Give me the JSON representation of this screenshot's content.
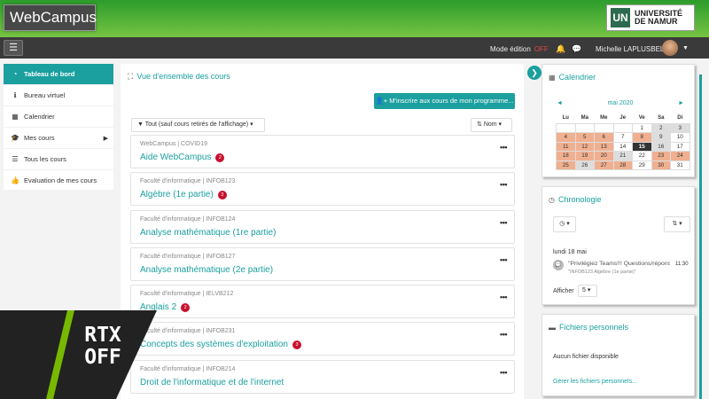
{
  "header": {
    "brand": "WebCampus",
    "university": [
      "UNIVERSITÉ",
      "DE NAMUR"
    ],
    "university_mark": "UN",
    "menu_icon": "hamburger-icon",
    "edit_mode_label": "Mode édition",
    "edit_mode_state": "OFF",
    "user_name": "Michelle LAPLUSBELLE",
    "icons": [
      "bell-icon",
      "chat-icon",
      "caret-down-icon"
    ],
    "accent": "#1b9f9f"
  },
  "sidebar": {
    "items": [
      {
        "label": "Tableau de bord",
        "icon": "dashboard-icon",
        "active": true
      },
      {
        "label": "Bureau virtuel",
        "icon": "info-icon"
      },
      {
        "label": "Calendrier",
        "icon": "calendar-icon"
      },
      {
        "label": "Mes cours",
        "icon": "graduation-cap-icon",
        "submenu": true
      },
      {
        "label": "Tous les cours",
        "icon": "list-icon"
      },
      {
        "label": "Evaluation de mes cours",
        "icon": "thumbs-up-icon"
      }
    ]
  },
  "main": {
    "title": "Vue d'ensemble des cours",
    "enroll_button": "M'inscrire aux cours de mon programme...",
    "filter": "Tout (sauf cours retirés de l'affichage)",
    "sort": "Nom",
    "courses": [
      {
        "category": "WebCampus | COVID19",
        "name": "Aide WebCampus",
        "badge": "2"
      },
      {
        "category": "Faculté d'informatique | INFOB123",
        "name": "Algèbre (1e partie)",
        "badge": "3"
      },
      {
        "category": "Faculté d'informatique | INFOB124",
        "name": "Analyse mathématique (1re partie)",
        "badge": ""
      },
      {
        "category": "Faculté d'informatique | INFOB127",
        "name": "Analyse mathématique (2e partie)",
        "badge": ""
      },
      {
        "category": "Faculté d'informatique | IELVB212",
        "name": "Anglais 2",
        "badge": "2"
      },
      {
        "category": "Faculté d'informatique | INFOB231",
        "name": "Concepts des systèmes d'exploitation",
        "badge": "3"
      },
      {
        "category": "Faculté d'informatique | INFOB214",
        "name": "Droit de l'informatique et de l'internet",
        "badge": ""
      }
    ]
  },
  "calendar": {
    "title": "Calendrier",
    "month": "mai 2020",
    "prev": "◄",
    "next": "►",
    "weekdays": [
      "Lu",
      "Ma",
      "Me",
      "Je",
      "Ve",
      "Sa",
      "Di"
    ],
    "today": 15
  },
  "timeline": {
    "title": "Chronologie",
    "date": "lundi 18 mai",
    "event_title": "\"Privilégiez Teams!!! Questions/réponses...",
    "event_sub": "\"INFOB123 Algèbre (1e partie)\"",
    "event_time": "11:30",
    "show_label": "Afficher",
    "show_count": "5"
  },
  "files": {
    "title": "Fichiers personnels",
    "empty": "Aucun fichier disponible",
    "manage": "Gérer les fichiers personnels..."
  },
  "overlay": {
    "label_line1": "RTX",
    "label_line2": "OFF"
  }
}
